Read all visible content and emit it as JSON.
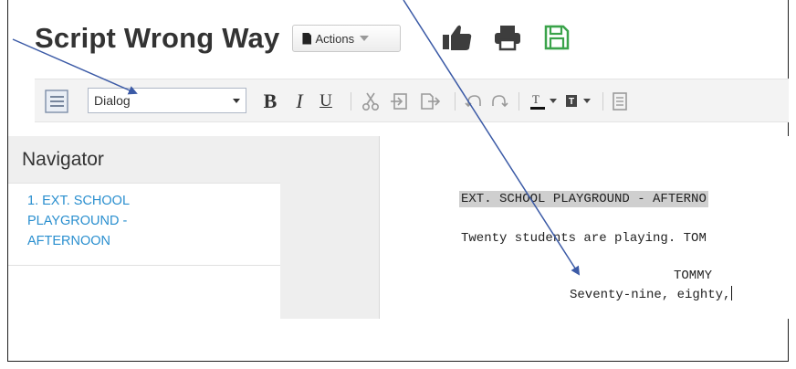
{
  "header": {
    "title": "Script Wrong Way",
    "actions_label": "Actions"
  },
  "toolbar": {
    "style_select_value": "Dialog",
    "bold_glyph": "B",
    "italic_glyph": "I",
    "underline_glyph": "U"
  },
  "navigator": {
    "heading": "Navigator",
    "items": [
      {
        "label": "1. EXT. SCHOOL PLAYGROUND - AFTERNOON"
      }
    ]
  },
  "script": {
    "scene_heading": "EXT. SCHOOL PLAYGROUND - AFTERNO",
    "action": "Twenty students are playing. TOM",
    "character": "TOMMY",
    "dialog": "Seventy-nine, eighty,"
  },
  "colors": {
    "link": "#2a8fcf",
    "arrow": "#3b5aa6",
    "save_icon": "#3aa34a"
  }
}
